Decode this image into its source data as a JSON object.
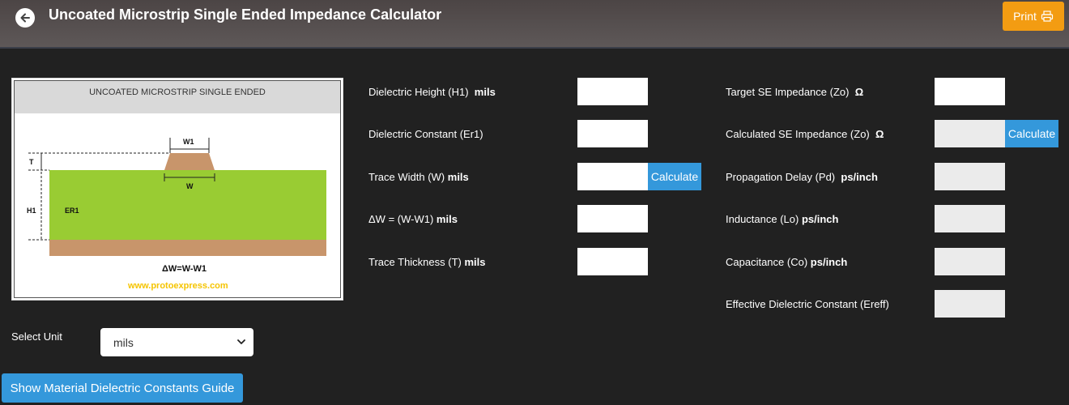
{
  "header": {
    "title": "Uncoated Microstrip Single Ended Impedance Calculator",
    "print_label": "Print"
  },
  "diagram": {
    "heading": "UNCOATED MICROSTRIP SINGLE ENDED",
    "label_w1": "W1",
    "label_w": "W",
    "label_t": "T",
    "label_h1": "H1",
    "label_er1": "ER1",
    "formula": "ΔW=W-W1",
    "website": "www.protoexpress.com"
  },
  "inputs": {
    "dielectric_height": {
      "label": "Dielectric Height (H1)",
      "unit": "mils",
      "value": ""
    },
    "dielectric_constant": {
      "label": "Dielectric Constant (Er1)",
      "value": ""
    },
    "trace_width": {
      "label": "Trace Width (W)",
      "unit": "mils",
      "value": "",
      "button": "Calculate"
    },
    "delta_w": {
      "label": "ΔW = (W-W1)",
      "unit": "mils",
      "value": ""
    },
    "trace_thickness": {
      "label": "Trace Thickness (T)",
      "unit": "mils",
      "value": ""
    }
  },
  "outputs": {
    "target_impedance": {
      "label": "Target SE Impedance (Zo)",
      "unit": "Ω",
      "value": ""
    },
    "calculated_impedance": {
      "label": "Calculated SE Impedance (Zo)",
      "unit": "Ω",
      "value": "",
      "button": "Calculate"
    },
    "propagation_delay": {
      "label": "Propagation Delay (Pd)",
      "unit": "ps/inch",
      "value": ""
    },
    "inductance": {
      "label": "Inductance (Lo)",
      "unit": "ps/inch",
      "value": ""
    },
    "capacitance": {
      "label": "Capacitance (Co)",
      "unit": "ps/inch",
      "value": ""
    },
    "effective_dielectric": {
      "label": "Effective Dielectric Constant (Ereff)",
      "value": ""
    }
  },
  "unit_selector": {
    "label": "Select Unit",
    "selected": "mils"
  },
  "guide_button": "Show Material Dielectric Constants Guide",
  "colors": {
    "accent": "#3498db",
    "print": "#f39c12",
    "dielectric": "#99cc33",
    "copper": "#c8956b",
    "website": "#f5c400"
  }
}
